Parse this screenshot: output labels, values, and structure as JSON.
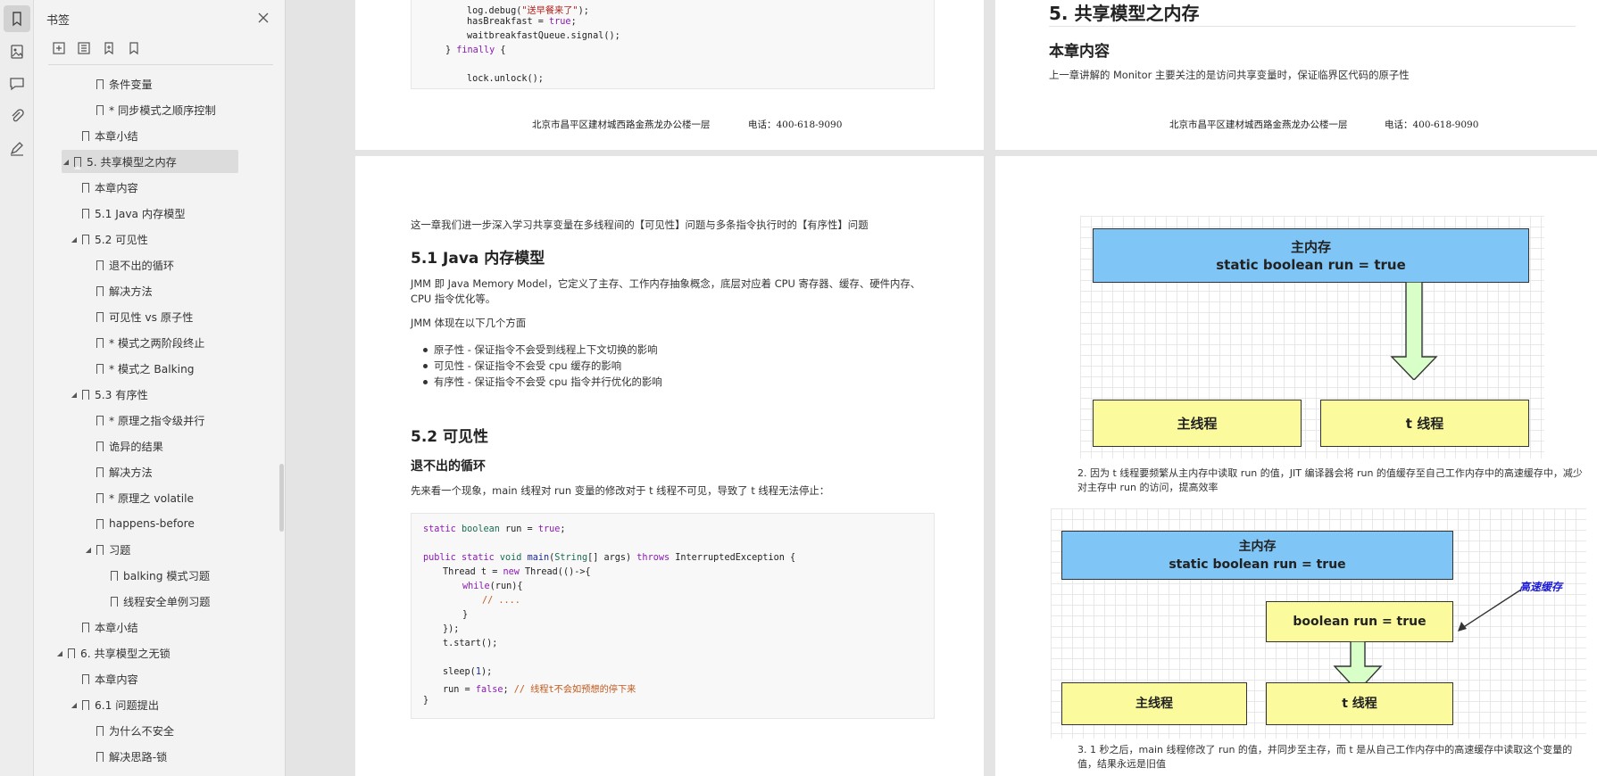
{
  "rail": {
    "items": [
      "bookmark-icon",
      "thumbnail-icon",
      "comment-icon",
      "attachment-icon",
      "signature-icon"
    ]
  },
  "panel": {
    "title": "书签",
    "outline": [
      {
        "label": "条件变量",
        "level": 3
      },
      {
        "label": "* 同步模式之顺序控制",
        "level": 3
      },
      {
        "label": "本章小结",
        "level": 2
      },
      {
        "label": "5. 共享模型之内存",
        "level": 1,
        "expanded": true,
        "selected": true
      },
      {
        "label": "本章内容",
        "level": 2
      },
      {
        "label": "5.1 Java 内存模型",
        "level": 2
      },
      {
        "label": "5.2 可见性",
        "level": 2,
        "expanded": true
      },
      {
        "label": "退不出的循环",
        "level": 3
      },
      {
        "label": "解决方法",
        "level": 3
      },
      {
        "label": "可见性 vs 原子性",
        "level": 3
      },
      {
        "label": "* 模式之两阶段终止",
        "level": 3
      },
      {
        "label": "* 模式之 Balking",
        "level": 3
      },
      {
        "label": "5.3 有序性",
        "level": 2,
        "expanded": true
      },
      {
        "label": "* 原理之指令级并行",
        "level": 3
      },
      {
        "label": "诡异的结果",
        "level": 3
      },
      {
        "label": "解决方法",
        "level": 3
      },
      {
        "label": "* 原理之 volatile",
        "level": 3
      },
      {
        "label": "happens-before",
        "level": 3
      },
      {
        "label": "习题",
        "level": 3,
        "expanded": true
      },
      {
        "label": "balking 模式习题",
        "level": 4
      },
      {
        "label": "线程安全单例习题",
        "level": 4
      },
      {
        "label": "本章小结",
        "level": 2
      },
      {
        "label": "6. 共享模型之无锁",
        "level": 1,
        "expanded": true
      },
      {
        "label": "本章内容",
        "level": 2
      },
      {
        "label": "6.1 问题提出",
        "level": 2,
        "expanded": true
      },
      {
        "label": "为什么不安全",
        "level": 3
      },
      {
        "label": "解决思路-锁",
        "level": 3
      }
    ]
  },
  "page_tl": {
    "code_lines": [
      "log.debug(\"送早餐来了\");",
      "hasBreakfast = true;",
      "waitbreakfastQueue.signal();",
      "} finally {",
      "",
      "lock.unlock();"
    ],
    "footer_address": "北京市昌平区建材城西路金燕龙办公楼一层",
    "footer_phone": "电话：400-618-9090"
  },
  "page_tr": {
    "heading": "5. 共享模型之内存",
    "subheading": "本章内容",
    "paragraph": "上一章讲解的 Monitor 主要关注的是访问共享变量时，保证临界区代码的原子性",
    "footer_address": "北京市昌平区建材城西路金燕龙办公楼一层",
    "footer_phone": "电话：400-618-9090"
  },
  "page_bl": {
    "intro": "这一章我们进一步深入学习共享变量在多线程间的【可见性】问题与多条指令执行时的【有序性】问题",
    "h_jmm": "5.1 Java 内存模型",
    "jmm_desc": "JMM 即 Java Memory Model，它定义了主存、工作内存抽象概念，底层对应着 CPU 寄存器、缓存、硬件内存、CPU 指令优化等。",
    "jmm_aspects": "JMM 体现在以下几个方面",
    "bullets": [
      "原子性 - 保证指令不会受到线程上下文切换的影响",
      "可见性 - 保证指令不会受 cpu 缓存的影响",
      "有序性 - 保证指令不会受 cpu 指令并行优化的影响"
    ],
    "h_visibility": "5.2 可见性",
    "h_loop": "退不出的循环",
    "loop_desc": "先来看一个现象，main 线程对 run 变量的修改对于 t 线程不可见，导致了 t 线程无法停止：",
    "code": {
      "l1": "static boolean run = true;",
      "l3": "public static void main(String[] args) throws InterruptedException {",
      "l4": "Thread t = new Thread(()->{",
      "l5": "while(run){",
      "l6": "// ....",
      "l7": "}",
      "l8": "});",
      "l9": "t.start();",
      "l11": "sleep(1);",
      "l12": "run = false; // 线程t不会如预想的停下来",
      "l13": "}"
    }
  },
  "page_br": {
    "diagram1": {
      "main_memory_title": "主内存",
      "main_memory_value": "static boolean run = true",
      "main_thread": "主线程",
      "t_thread": "t 线程"
    },
    "step2": "2. 因为 t 线程要频繁从主内存中读取 run 的值，JIT 编译器会将 run 的值缓存至自己工作内存中的高速缓存中，减少对主存中 run 的访问，提高效率",
    "diagram2": {
      "main_memory_title": "主内存",
      "main_memory_value": "static boolean run = true",
      "cache_label": "高速缓存",
      "cache_value": "boolean run = true",
      "main_thread": "主线程",
      "t_thread": "t 线程"
    },
    "step3": "3. 1 秒之后，main 线程修改了 run 的值，并同步至主存，而 t 是从自己工作内存中的高速缓存中读取这个变量的值，结果永远是旧值"
  },
  "colors": {
    "blue_box": "#7fc6f6",
    "yellow_box": "#fbfb9e",
    "arrow_fill": "#d9ffc9",
    "cache_label": "#1a1ad6"
  }
}
